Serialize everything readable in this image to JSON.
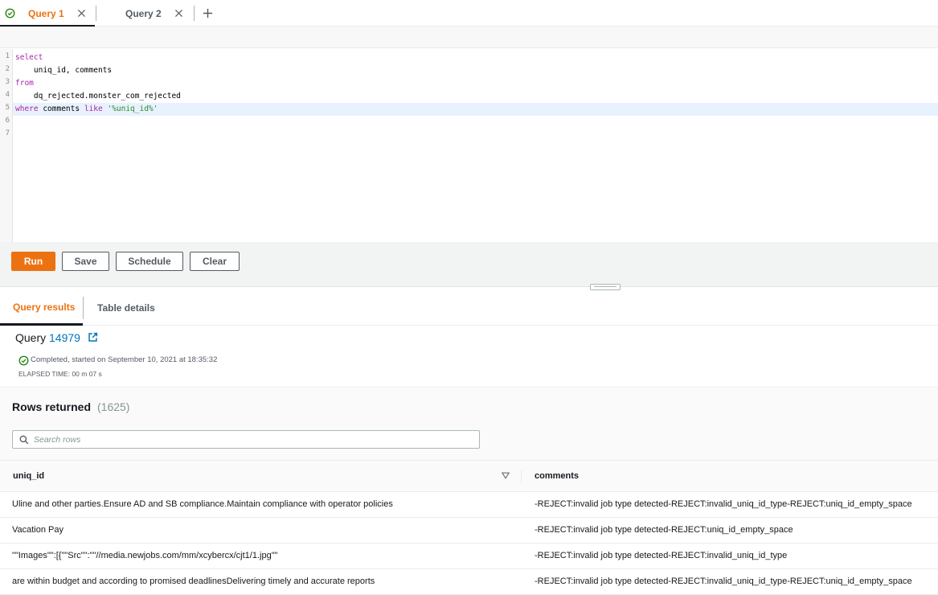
{
  "tabs": [
    {
      "label": "Query 1",
      "active": true,
      "status": "completed"
    },
    {
      "label": "Query 2",
      "active": false
    }
  ],
  "editor": {
    "line_numbers": [
      "1",
      "2",
      "3",
      "4",
      "5",
      "6",
      "7"
    ],
    "lines": [
      [
        {
          "t": "select",
          "k": "kw"
        }
      ],
      [
        {
          "t": "    uniq_id, comments",
          "k": ""
        }
      ],
      [
        {
          "t": "from",
          "k": "kw"
        }
      ],
      [
        {
          "t": "    dq_rejected.monster_com_rejected",
          "k": ""
        }
      ],
      [
        {
          "t": "where",
          "k": "kw"
        },
        {
          "t": " comments ",
          "k": ""
        },
        {
          "t": "like",
          "k": "kw"
        },
        {
          "t": " ",
          "k": ""
        },
        {
          "t": "'%uniq_id%'",
          "k": "str"
        }
      ],
      [],
      []
    ],
    "active_line": 5
  },
  "buttons": {
    "run": "Run",
    "save": "Save",
    "schedule": "Schedule",
    "clear": "Clear"
  },
  "result_tabs": {
    "query_results": "Query results",
    "table_details": "Table details"
  },
  "query_info": {
    "title_prefix": "Query",
    "query_id": "14979",
    "status": "Completed, started on September 10, 2021 at 18:35:32",
    "elapsed": "ELAPSED TIME: 00 m 07 s"
  },
  "rows": {
    "title": "Rows returned",
    "count": "(1625)",
    "search_placeholder": "Search rows",
    "columns": [
      "uniq_id",
      "comments"
    ],
    "data": [
      {
        "uniq_id": "Uline and other parties.Ensure AD and SB compliance.Maintain compliance with operator policies",
        "comments": "-REJECT:invalid job type detected-REJECT:invalid_uniq_id_type-REJECT:uniq_id_empty_space"
      },
      {
        "uniq_id": "Vacation Pay",
        "comments": "-REJECT:invalid job type detected-REJECT:uniq_id_empty_space"
      },
      {
        "uniq_id": "\"\"Images\"\":[{\"\"Src\"\":\"\"//media.newjobs.com/mm/xcybercx/cjt1/1.jpg\"\"",
        "comments": "-REJECT:invalid job type detected-REJECT:invalid_uniq_id_type"
      },
      {
        "uniq_id": "are within budget and according to promised deadlinesDelivering timely and accurate reports",
        "comments": "-REJECT:invalid job type detected-REJECT:invalid_uniq_id_type-REJECT:uniq_id_empty_space"
      }
    ]
  },
  "colors": {
    "accent": "#ec7211",
    "link": "#0073bb",
    "success": "#1d8102",
    "keyword": "#a626a4",
    "string": "#2f8a2f"
  }
}
